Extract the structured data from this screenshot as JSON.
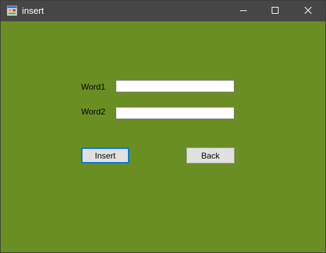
{
  "window": {
    "title": "insert",
    "icons": {
      "app": "app-form-icon",
      "minimize": "minimize-icon",
      "maximize": "maximize-icon",
      "close": "close-icon",
      "resize": "resize-grip-icon"
    }
  },
  "form": {
    "word1_label": "Word1",
    "word1_value": "",
    "word2_label": "Word2",
    "word2_value": "",
    "insert_label": "Insert",
    "back_label": "Back"
  },
  "colors": {
    "background": "#6b8e23",
    "titlebar": "#464646",
    "focus": "#0078d7"
  }
}
